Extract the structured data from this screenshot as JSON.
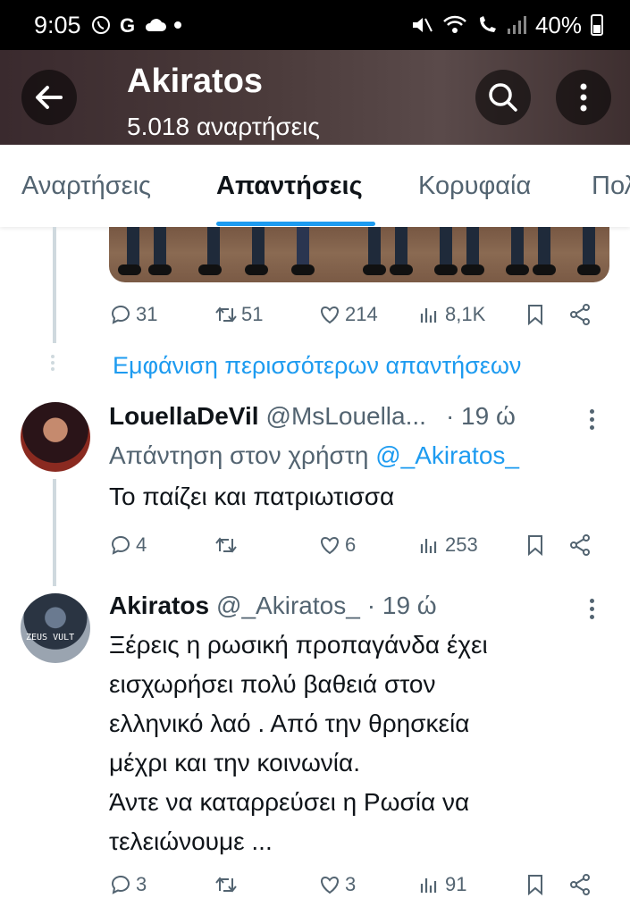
{
  "status_bar": {
    "time": "9:05",
    "left_icons": [
      "viber-icon",
      "google-icon",
      "cloud-icon",
      "dot-icon"
    ],
    "right_icons": [
      "mute-icon",
      "wifi-icon",
      "call-wifi-icon",
      "signal-icon"
    ],
    "battery": "40%"
  },
  "header": {
    "title": "Akiratos",
    "subtitle": "5.018 αναρτήσεις"
  },
  "tabs": [
    {
      "label": "Αναρτήσεις",
      "active": false
    },
    {
      "label": "Απαντήσεις",
      "active": true
    },
    {
      "label": "Κορυφαία",
      "active": false
    },
    {
      "label": "Πολυμέσα",
      "active": false
    }
  ],
  "colors": {
    "accent": "#1d9bf0",
    "text": "#0f1419",
    "secondary": "#536471",
    "thread_line": "#cfd9de"
  },
  "tweets": [
    {
      "actions": {
        "replies": "31",
        "retweets": "51",
        "likes": "214",
        "views": "8,1K"
      }
    },
    {
      "name": "LouellaDeVil",
      "handle": "@MsLouella...",
      "time": "· 19 ώ",
      "reply_prefix": "Απάντηση στον χρήστη",
      "reply_mention": "@_Akiratos_",
      "text": "Το παίζει και πατριωτισσα",
      "actions": {
        "replies": "4",
        "retweets": "",
        "likes": "6",
        "views": "253"
      }
    },
    {
      "name": "Akiratos",
      "handle": "@_Akiratos_",
      "time": "· 19 ώ",
      "avatar_text": "ZEUS VULT",
      "text_lines": [
        "Ξέρεις η ρωσική προπαγάνδα έχει",
        "εισχωρήσει πολύ βαθειά στον",
        "ελληνικό λαό . Από την θρησκεία",
        "μέχρι και την κοινωνία.",
        "Άντε να καταρρεύσει η Ρωσία να",
        "τελειώνουμε ..."
      ],
      "actions": {
        "replies": "3",
        "retweets": "",
        "likes": "3",
        "views": "91"
      }
    }
  ],
  "more_replies": "Εμφάνιση περισσότερων απαντήσεων"
}
